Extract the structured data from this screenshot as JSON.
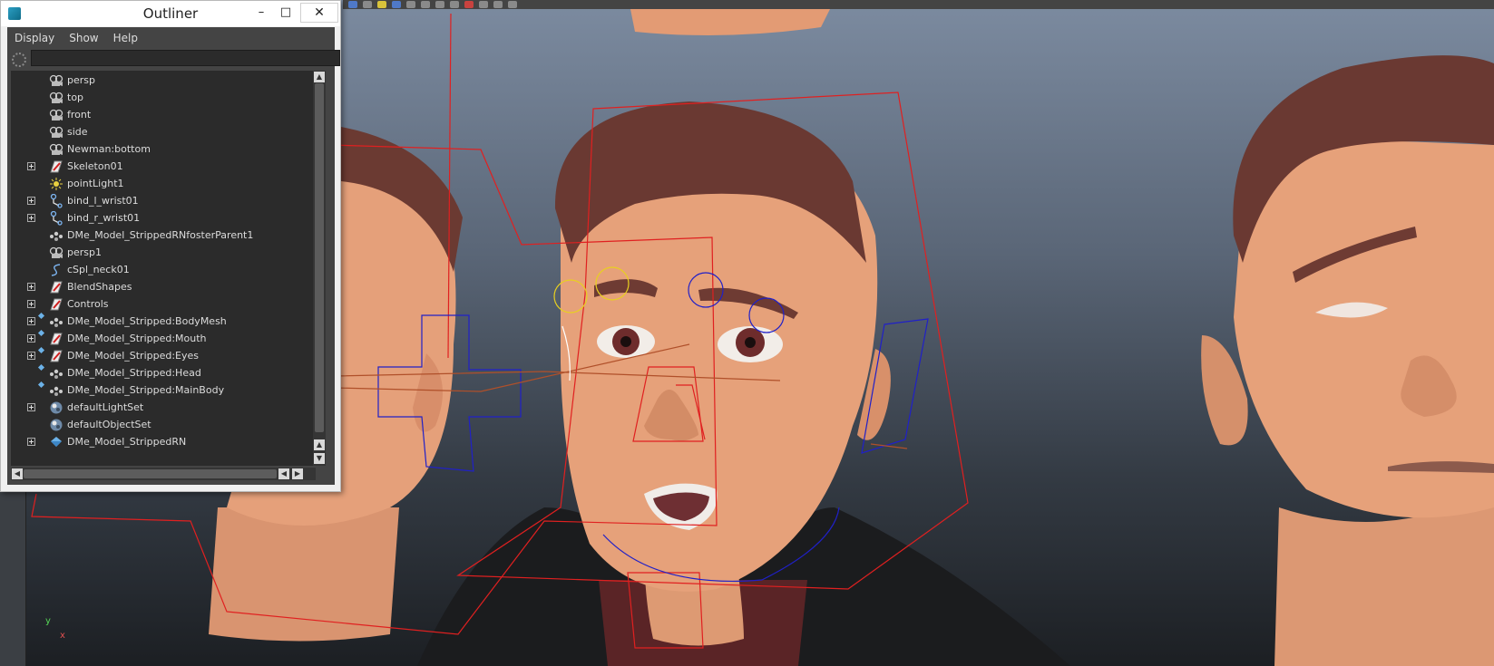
{
  "outliner": {
    "title": "Outliner",
    "window_buttons": {
      "minimize": "–",
      "maximize": "□",
      "close": "✕"
    },
    "menu": [
      "Display",
      "Show",
      "Help"
    ],
    "search_value": "",
    "items": [
      {
        "label": "persp",
        "icon": "camera-icon",
        "expandable": false,
        "referenced": false
      },
      {
        "label": "top",
        "icon": "camera-icon",
        "expandable": false,
        "referenced": false
      },
      {
        "label": "front",
        "icon": "camera-icon",
        "expandable": false,
        "referenced": false
      },
      {
        "label": "side",
        "icon": "camera-icon",
        "expandable": false,
        "referenced": false
      },
      {
        "label": "Newman:bottom",
        "icon": "camera-icon",
        "expandable": false,
        "referenced": false
      },
      {
        "label": "Skeleton01",
        "icon": "transform-node-icon",
        "expandable": true,
        "referenced": false
      },
      {
        "label": "pointLight1",
        "icon": "point-light-icon",
        "expandable": false,
        "referenced": false
      },
      {
        "label": "bind_l_wrist01",
        "icon": "joint-icon",
        "expandable": true,
        "referenced": false
      },
      {
        "label": "bind_r_wrist01",
        "icon": "joint-icon",
        "expandable": true,
        "referenced": false
      },
      {
        "label": "DMe_Model_StrippedRNfosterParent1",
        "icon": "mesh-group-icon",
        "expandable": false,
        "referenced": false
      },
      {
        "label": "persp1",
        "icon": "camera-icon",
        "expandable": false,
        "referenced": false
      },
      {
        "label": "cSpl_neck01",
        "icon": "curve-icon",
        "expandable": false,
        "referenced": false
      },
      {
        "label": "BlendShapes",
        "icon": "transform-node-icon",
        "expandable": true,
        "referenced": false
      },
      {
        "label": "Controls",
        "icon": "transform-node-icon",
        "expandable": true,
        "referenced": false
      },
      {
        "label": "DMe_Model_Stripped:BodyMesh",
        "icon": "mesh-group-icon",
        "expandable": true,
        "referenced": true
      },
      {
        "label": "DMe_Model_Stripped:Mouth",
        "icon": "transform-node-icon",
        "expandable": true,
        "referenced": true
      },
      {
        "label": "DMe_Model_Stripped:Eyes",
        "icon": "transform-node-icon",
        "expandable": true,
        "referenced": true
      },
      {
        "label": "DMe_Model_Stripped:Head",
        "icon": "mesh-group-icon",
        "expandable": false,
        "referenced": true
      },
      {
        "label": "DMe_Model_Stripped:MainBody",
        "icon": "mesh-group-icon",
        "expandable": false,
        "referenced": true
      },
      {
        "label": "defaultLightSet",
        "icon": "set-icon",
        "expandable": true,
        "referenced": false
      },
      {
        "label": "defaultObjectSet",
        "icon": "set-icon",
        "expandable": false,
        "referenced": false
      },
      {
        "label": "DMe_Model_StrippedRN",
        "icon": "reference-icon",
        "expandable": true,
        "referenced": false
      }
    ]
  },
  "viewport": {
    "axis_y": "y",
    "axis_x": "x",
    "colors": {
      "skin": "#e9a57e",
      "hair": "#6e3b33",
      "control_red": "#e02020",
      "control_blue": "#2020c8",
      "control_yellow": "#e8d020"
    }
  }
}
